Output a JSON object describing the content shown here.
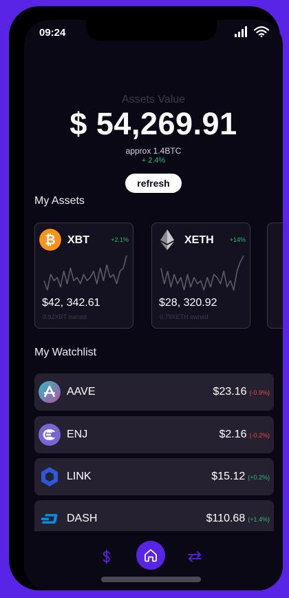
{
  "status": {
    "time": "09:24"
  },
  "header": {
    "assets_label": "Assets Value",
    "assets_value": "$ 54,269.91",
    "approx": "approx 1.4BTC",
    "change": "+ 2.4%",
    "refresh_label": "refresh"
  },
  "my_assets": {
    "title": "My Assets",
    "cards": [
      {
        "ticker": "XBT",
        "change": "+2.1%",
        "price": "$42, 342.61",
        "owned": "0.92XBT owned",
        "icon": "bitcoin-icon",
        "sparkline": [
          5,
          2,
          7,
          5,
          6,
          3,
          8,
          4,
          9,
          5,
          6,
          4,
          7,
          5,
          6,
          8,
          4,
          9,
          5,
          10,
          6,
          7,
          4,
          8,
          9,
          13
        ]
      },
      {
        "ticker": "XETH",
        "change": "+14%",
        "price": "$28, 320.92",
        "owned": "0.79XETH owned",
        "icon": "ethereum-icon",
        "sparkline": [
          9,
          4,
          8,
          3,
          7,
          4,
          6,
          2,
          7,
          3,
          6,
          4,
          5,
          2,
          6,
          3,
          7,
          6,
          4,
          8,
          3,
          5,
          2,
          8,
          11,
          13
        ]
      }
    ]
  },
  "watchlist": {
    "title": "My Watchlist",
    "items": [
      {
        "name": "AAVE",
        "price": "$23.16",
        "change": "(-0.9%)",
        "direction": "down",
        "icon": "aave-icon"
      },
      {
        "name": "ENJ",
        "price": "$2.16",
        "change": "(-0.2%)",
        "direction": "down",
        "icon": "enjin-icon"
      },
      {
        "name": "LINK",
        "price": "$15.12",
        "change": "(+0.2%)",
        "direction": "up",
        "icon": "chainlink-icon"
      },
      {
        "name": "DASH",
        "price": "$110.68",
        "change": "(+1.4%)",
        "direction": "up",
        "icon": "dash-icon"
      }
    ]
  },
  "nav": {
    "items": [
      {
        "icon": "dollar-icon"
      },
      {
        "icon": "home-icon",
        "active": true
      },
      {
        "icon": "swap-icon"
      }
    ]
  },
  "colors": {
    "accent": "#5a24e6",
    "background": "#0b0816",
    "card": "#252130",
    "positive": "#2ebd6b",
    "negative": "#e5484d"
  }
}
